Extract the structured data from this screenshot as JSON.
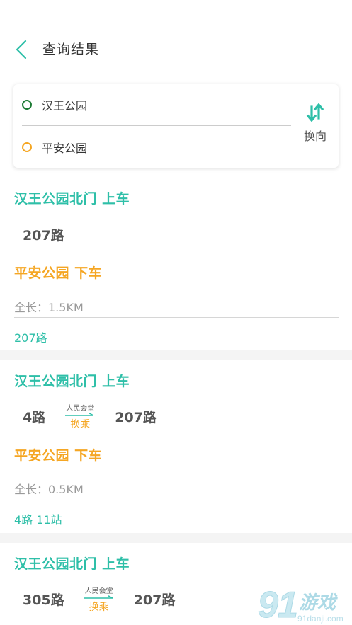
{
  "header": {
    "title": "查询结果"
  },
  "search": {
    "start": "汉王公园",
    "end": "平安公园",
    "swap_label": "换向"
  },
  "results": [
    {
      "board": "汉王公园北门 上车",
      "routes": [
        "207路"
      ],
      "alight": "平安公园 下车",
      "distance": "全长：1.5KM",
      "summary": "207路"
    },
    {
      "board": "汉王公园北门 上车",
      "routes": [
        "4路",
        "207路"
      ],
      "transfer_stop": "人民会堂",
      "transfer_label": "换乘",
      "alight": "平安公园 下车",
      "distance": "全长：0.5KM",
      "summary": "4路 11站"
    },
    {
      "board": "汉王公园北门 上车",
      "routes": [
        "305路",
        "207路"
      ],
      "transfer_stop": "人民会堂",
      "transfer_label": "换乘"
    }
  ],
  "watermark": {
    "brand": "91游戏",
    "url": "91danji.com"
  },
  "colors": {
    "accent_teal": "#2ebfa8",
    "accent_orange": "#f5a623",
    "start_dot": "#1d7b34"
  }
}
